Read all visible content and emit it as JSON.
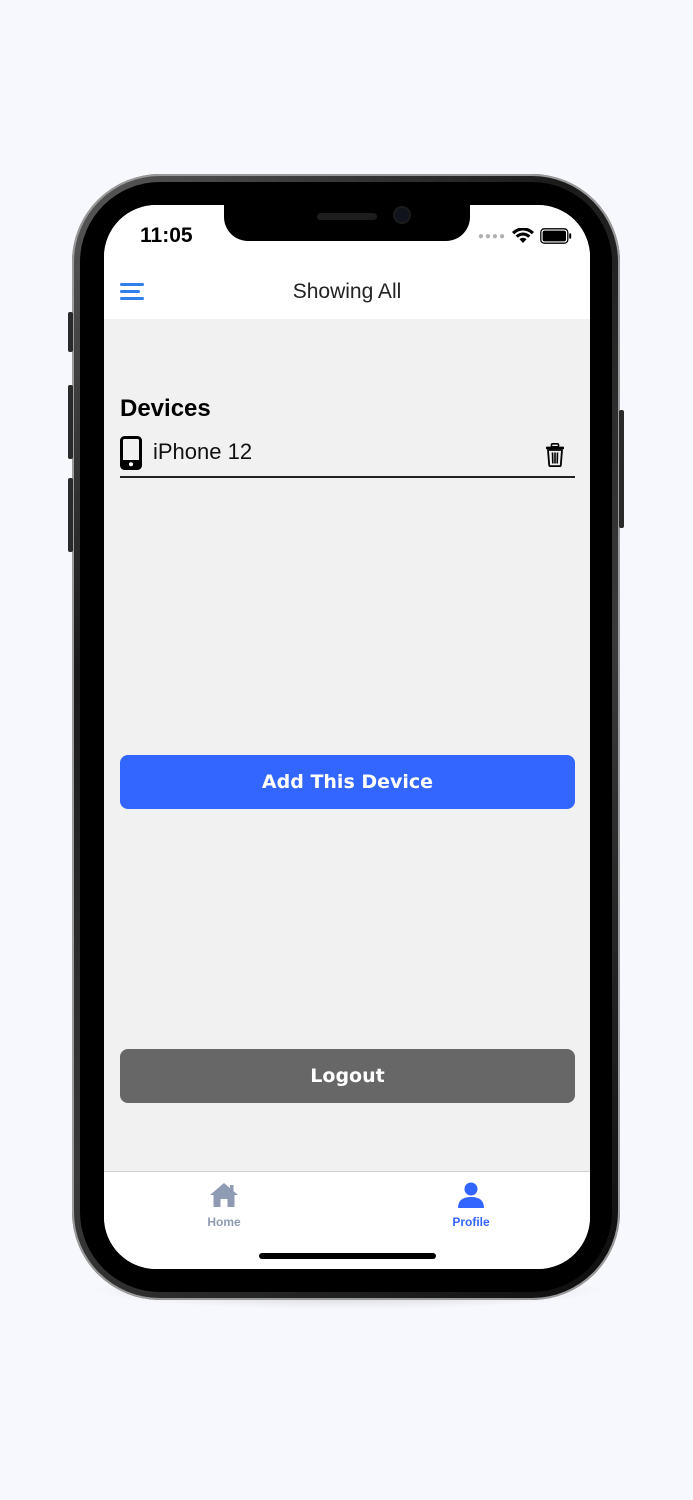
{
  "status_bar": {
    "time": "11:05"
  },
  "header": {
    "title": "Showing All"
  },
  "devices": {
    "title": "Devices",
    "items": [
      {
        "name": "iPhone 12",
        "icon": "smartphone-icon"
      }
    ]
  },
  "actions": {
    "add_device_label": "Add This Device",
    "logout_label": "Logout"
  },
  "tabbar": {
    "items": [
      {
        "label": "Home",
        "icon": "home-icon",
        "active": false
      },
      {
        "label": "Profile",
        "icon": "person-icon",
        "active": true
      }
    ]
  },
  "colors": {
    "accent": "#3366ff",
    "menu_icon": "#2f80ed",
    "logout": "#676767",
    "tab_inactive": "#8f9bb3",
    "tab_active": "#3366ff",
    "content_bg": "#f1f1f1"
  }
}
